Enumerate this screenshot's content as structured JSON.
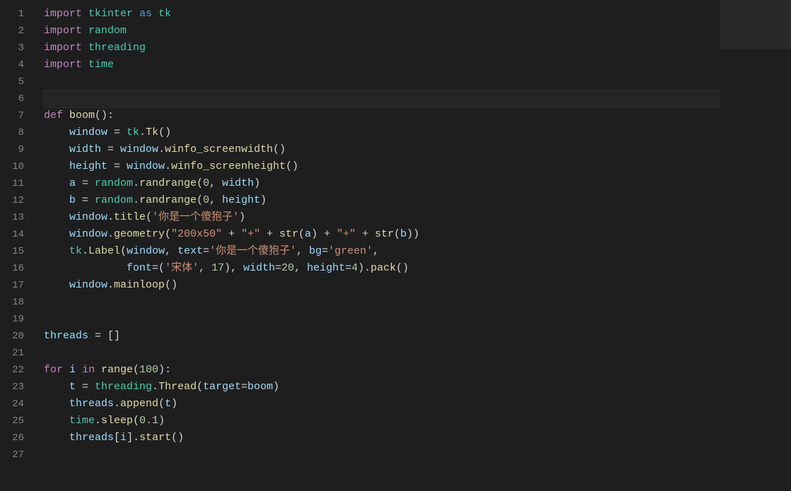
{
  "gutter": {
    "start": 1,
    "end": 27
  },
  "current_line": 6,
  "lines": [
    [
      [
        "kw",
        "import"
      ],
      [
        "op",
        " "
      ],
      [
        "mod",
        "tkinter"
      ],
      [
        "op",
        " "
      ],
      [
        "kw2",
        "as"
      ],
      [
        "op",
        " "
      ],
      [
        "mod",
        "tk"
      ]
    ],
    [
      [
        "kw",
        "import"
      ],
      [
        "op",
        " "
      ],
      [
        "mod",
        "random"
      ]
    ],
    [
      [
        "kw",
        "import"
      ],
      [
        "op",
        " "
      ],
      [
        "mod",
        "threading"
      ]
    ],
    [
      [
        "kw",
        "import"
      ],
      [
        "op",
        " "
      ],
      [
        "mod",
        "time"
      ]
    ],
    [],
    [],
    [
      [
        "kw",
        "def"
      ],
      [
        "op",
        " "
      ],
      [
        "fn",
        "boom"
      ],
      [
        "op",
        "():"
      ]
    ],
    [
      [
        "op",
        "    "
      ],
      [
        "var",
        "window"
      ],
      [
        "op",
        " = "
      ],
      [
        "mod",
        "tk"
      ],
      [
        "op",
        "."
      ],
      [
        "fn",
        "Tk"
      ],
      [
        "op",
        "()"
      ]
    ],
    [
      [
        "op",
        "    "
      ],
      [
        "var",
        "width"
      ],
      [
        "op",
        " = "
      ],
      [
        "var",
        "window"
      ],
      [
        "op",
        "."
      ],
      [
        "fn",
        "winfo_screenwidth"
      ],
      [
        "op",
        "()"
      ]
    ],
    [
      [
        "op",
        "    "
      ],
      [
        "var",
        "height"
      ],
      [
        "op",
        " = "
      ],
      [
        "var",
        "window"
      ],
      [
        "op",
        "."
      ],
      [
        "fn",
        "winfo_screenheight"
      ],
      [
        "op",
        "()"
      ]
    ],
    [
      [
        "op",
        "    "
      ],
      [
        "var",
        "a"
      ],
      [
        "op",
        " = "
      ],
      [
        "mod",
        "random"
      ],
      [
        "op",
        "."
      ],
      [
        "fn",
        "randrange"
      ],
      [
        "op",
        "("
      ],
      [
        "num",
        "0"
      ],
      [
        "op",
        ", "
      ],
      [
        "var",
        "width"
      ],
      [
        "op",
        ")"
      ]
    ],
    [
      [
        "op",
        "    "
      ],
      [
        "var",
        "b"
      ],
      [
        "op",
        " = "
      ],
      [
        "mod",
        "random"
      ],
      [
        "op",
        "."
      ],
      [
        "fn",
        "randrange"
      ],
      [
        "op",
        "("
      ],
      [
        "num",
        "0"
      ],
      [
        "op",
        ", "
      ],
      [
        "var",
        "height"
      ],
      [
        "op",
        ")"
      ]
    ],
    [
      [
        "op",
        "    "
      ],
      [
        "var",
        "window"
      ],
      [
        "op",
        "."
      ],
      [
        "fn",
        "title"
      ],
      [
        "op",
        "("
      ],
      [
        "str",
        "'你是一个傻狍子'"
      ],
      [
        "op",
        ")"
      ]
    ],
    [
      [
        "op",
        "    "
      ],
      [
        "var",
        "window"
      ],
      [
        "op",
        "."
      ],
      [
        "fn",
        "geometry"
      ],
      [
        "op",
        "("
      ],
      [
        "str",
        "\"200x50\""
      ],
      [
        "op",
        " + "
      ],
      [
        "str",
        "\"+\""
      ],
      [
        "op",
        " + "
      ],
      [
        "fn",
        "str"
      ],
      [
        "op",
        "("
      ],
      [
        "var",
        "a"
      ],
      [
        "op",
        ") + "
      ],
      [
        "str",
        "\"+\""
      ],
      [
        "op",
        " + "
      ],
      [
        "fn",
        "str"
      ],
      [
        "op",
        "("
      ],
      [
        "var",
        "b"
      ],
      [
        "op",
        "))"
      ]
    ],
    [
      [
        "op",
        "    "
      ],
      [
        "mod",
        "tk"
      ],
      [
        "op",
        "."
      ],
      [
        "fn",
        "Label"
      ],
      [
        "op",
        "("
      ],
      [
        "var",
        "window"
      ],
      [
        "op",
        ", "
      ],
      [
        "var",
        "text"
      ],
      [
        "op",
        "="
      ],
      [
        "str",
        "'你是一个傻狍子'"
      ],
      [
        "op",
        ", "
      ],
      [
        "var",
        "bg"
      ],
      [
        "op",
        "="
      ],
      [
        "str",
        "'green'"
      ],
      [
        "op",
        ","
      ]
    ],
    [
      [
        "op",
        "             "
      ],
      [
        "var",
        "font"
      ],
      [
        "op",
        "=("
      ],
      [
        "str",
        "'宋体'"
      ],
      [
        "op",
        ", "
      ],
      [
        "num",
        "17"
      ],
      [
        "op",
        "), "
      ],
      [
        "var",
        "width"
      ],
      [
        "op",
        "="
      ],
      [
        "num",
        "20"
      ],
      [
        "op",
        ", "
      ],
      [
        "var",
        "height"
      ],
      [
        "op",
        "="
      ],
      [
        "num",
        "4"
      ],
      [
        "op",
        ")."
      ],
      [
        "fn",
        "pack"
      ],
      [
        "op",
        "()"
      ]
    ],
    [
      [
        "op",
        "    "
      ],
      [
        "var",
        "window"
      ],
      [
        "op",
        "."
      ],
      [
        "fn",
        "mainloop"
      ],
      [
        "op",
        "()"
      ]
    ],
    [],
    [],
    [
      [
        "var",
        "threads"
      ],
      [
        "op",
        " = []"
      ]
    ],
    [],
    [
      [
        "kw",
        "for"
      ],
      [
        "op",
        " "
      ],
      [
        "var",
        "i"
      ],
      [
        "op",
        " "
      ],
      [
        "kw",
        "in"
      ],
      [
        "op",
        " "
      ],
      [
        "fn",
        "range"
      ],
      [
        "op",
        "("
      ],
      [
        "num",
        "100"
      ],
      [
        "op",
        "):"
      ]
    ],
    [
      [
        "op",
        "    "
      ],
      [
        "var",
        "t"
      ],
      [
        "op",
        " = "
      ],
      [
        "mod",
        "threading"
      ],
      [
        "op",
        "."
      ],
      [
        "fn",
        "Thread"
      ],
      [
        "op",
        "("
      ],
      [
        "var",
        "target"
      ],
      [
        "op",
        "="
      ],
      [
        "var",
        "boom"
      ],
      [
        "op",
        ")"
      ]
    ],
    [
      [
        "op",
        "    "
      ],
      [
        "var",
        "threads"
      ],
      [
        "op",
        "."
      ],
      [
        "fn",
        "append"
      ],
      [
        "op",
        "("
      ],
      [
        "var",
        "t"
      ],
      [
        "op",
        ")"
      ]
    ],
    [
      [
        "op",
        "    "
      ],
      [
        "mod",
        "time"
      ],
      [
        "op",
        "."
      ],
      [
        "fn",
        "sleep"
      ],
      [
        "op",
        "("
      ],
      [
        "num",
        "0.1"
      ],
      [
        "op",
        ")"
      ]
    ],
    [
      [
        "op",
        "    "
      ],
      [
        "var",
        "threads"
      ],
      [
        "op",
        "["
      ],
      [
        "var",
        "i"
      ],
      [
        "op",
        "]."
      ],
      [
        "fn",
        "start"
      ],
      [
        "op",
        "()"
      ]
    ],
    []
  ]
}
